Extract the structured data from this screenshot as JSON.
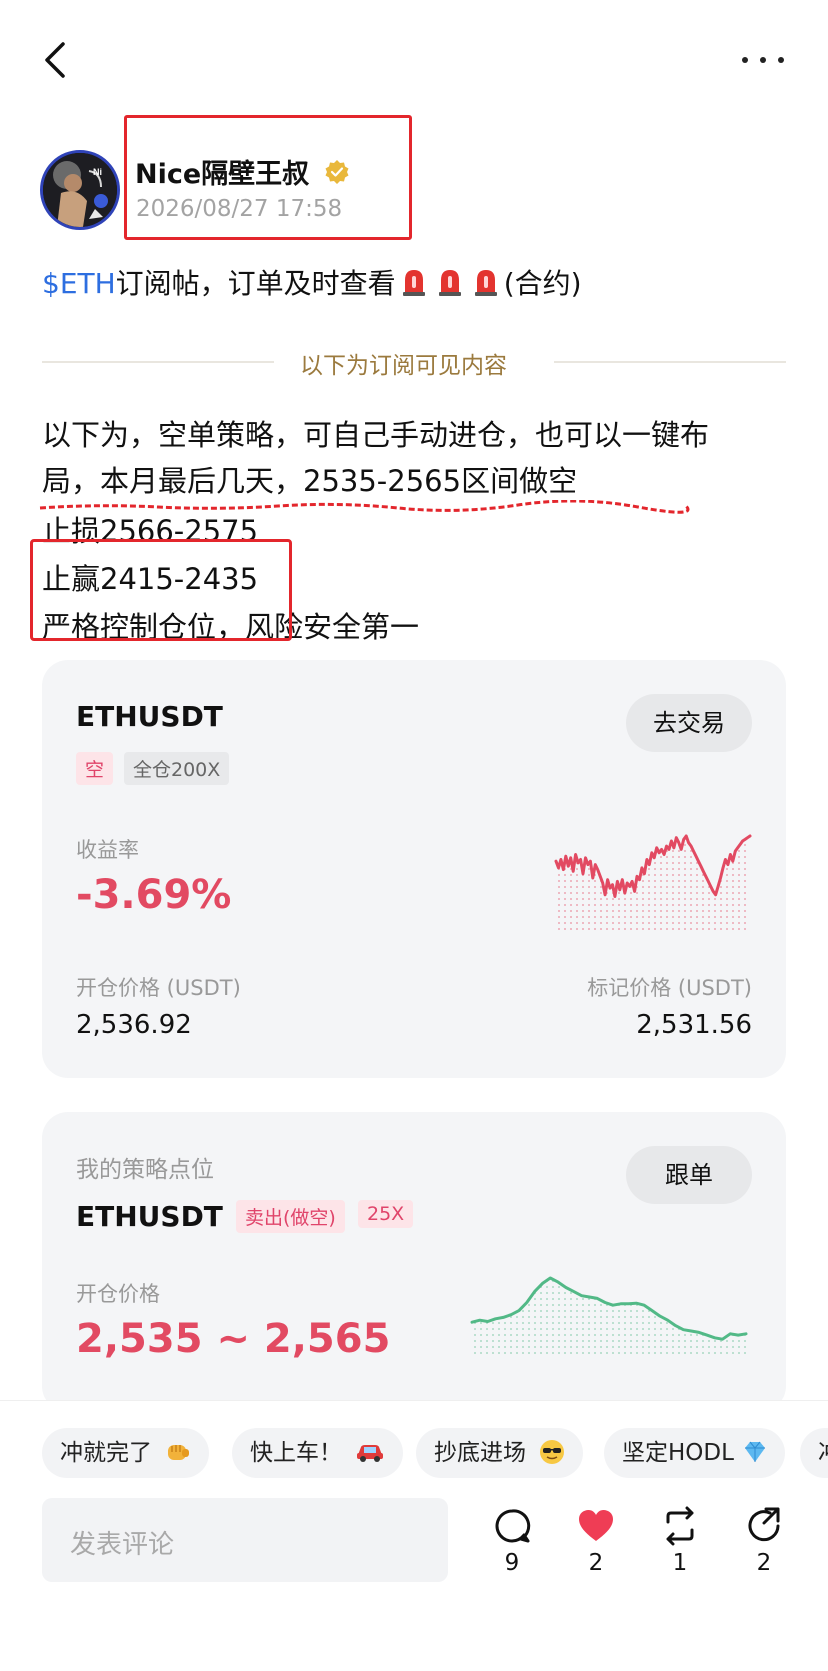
{
  "topbar": {
    "back_icon": "chevron-left-icon",
    "more_icon": "more-dots-icon"
  },
  "author": {
    "name": "Nice隔壁王叔",
    "time": "2026/08/27 17:58",
    "verified_icon": "verified-badge-icon"
  },
  "post": {
    "title_tag": "$ETH",
    "title_text": "订阅帖，订单及时查看",
    "title_suffix": "(合约)",
    "siren_icon": "siren-emoji-icon",
    "divider_label": "以下为订阅可见内容",
    "lines": [
      "以下为，空单策略，可自己手动进仓，也可以一键布",
      "局，本月最后几天，2535-2565区间做空",
      "止损2566-2575",
      "止赢2415-2435",
      "严格控制仓位，风险安全第一"
    ]
  },
  "position_card": {
    "symbol": "ETHUSDT",
    "trade_button": "去交易",
    "side_tag": "空",
    "leverage_tag": "全仓200X",
    "yield_label": "收益率",
    "yield_value": "-3.69%",
    "open_price_label": "开仓价格 (USDT)",
    "open_price": "2,536.92",
    "mark_price_label": "标记价格 (USDT)",
    "mark_price": "2,531.56",
    "sparkline_color": "#e24a62",
    "sparkline": [
      0.7,
      0.62,
      0.72,
      0.6,
      0.76,
      0.64,
      0.74,
      0.58,
      0.78,
      0.68,
      0.72,
      0.55,
      0.74,
      0.66,
      0.7,
      0.5,
      0.66,
      0.6,
      0.52,
      0.44,
      0.3,
      0.48,
      0.38,
      0.42,
      0.28,
      0.46,
      0.36,
      0.48,
      0.32,
      0.44,
      0.4,
      0.46,
      0.34,
      0.52,
      0.48,
      0.62,
      0.55,
      0.72,
      0.66,
      0.8,
      0.74,
      0.86,
      0.8,
      0.84,
      0.78,
      0.88,
      0.84,
      0.94,
      0.86,
      0.98,
      0.92,
      0.84,
      0.96,
      1.0,
      0.92,
      0.88,
      0.82,
      0.76,
      0.7,
      0.64,
      0.58,
      0.52,
      0.46,
      0.4,
      0.34,
      0.3,
      0.4,
      0.5,
      0.62,
      0.72,
      0.66,
      0.78,
      0.7,
      0.82,
      0.86,
      0.9,
      0.94,
      0.96,
      0.98,
      1.0
    ]
  },
  "strategy_card": {
    "label": "我的策略点位",
    "follow_button": "跟单",
    "symbol": "ETHUSDT",
    "side_tag": "卖出(做空)",
    "leverage_tag": "25X",
    "open_price_label": "开仓价格",
    "open_price_range": "2,535 ~ 2,565",
    "sparkline_color": "#52b987",
    "sparkline": [
      0.35,
      0.38,
      0.36,
      0.4,
      0.42,
      0.46,
      0.52,
      0.64,
      0.8,
      0.92,
      1.0,
      0.94,
      0.86,
      0.8,
      0.74,
      0.72,
      0.7,
      0.64,
      0.6,
      0.62,
      0.62,
      0.63,
      0.6,
      0.52,
      0.44,
      0.38,
      0.3,
      0.24,
      0.22,
      0.2,
      0.16,
      0.12,
      0.1,
      0.18,
      0.16,
      0.18
    ]
  },
  "quick_replies": [
    {
      "text": "冲就完了",
      "icon": "fist-emoji-icon"
    },
    {
      "text": "快上车！",
      "icon": "car-emoji-icon"
    },
    {
      "text": "抄底进场",
      "icon": "sunglasses-emoji-icon"
    },
    {
      "text": "坚定HODL",
      "icon": "diamond-emoji-icon"
    },
    {
      "text": "冲",
      "icon": ""
    }
  ],
  "comment_placeholder": "发表评论",
  "actions": [
    {
      "icon": "comment-icon",
      "count": "9"
    },
    {
      "icon": "heart-icon",
      "count": "2"
    },
    {
      "icon": "repost-icon",
      "count": "1"
    },
    {
      "icon": "share-icon",
      "count": "2"
    }
  ],
  "colors": {
    "accent_red": "#e24a62",
    "link_blue": "#2d6ee0",
    "divider_gold": "#9b7a3e",
    "like_red": "#ef3d55"
  }
}
